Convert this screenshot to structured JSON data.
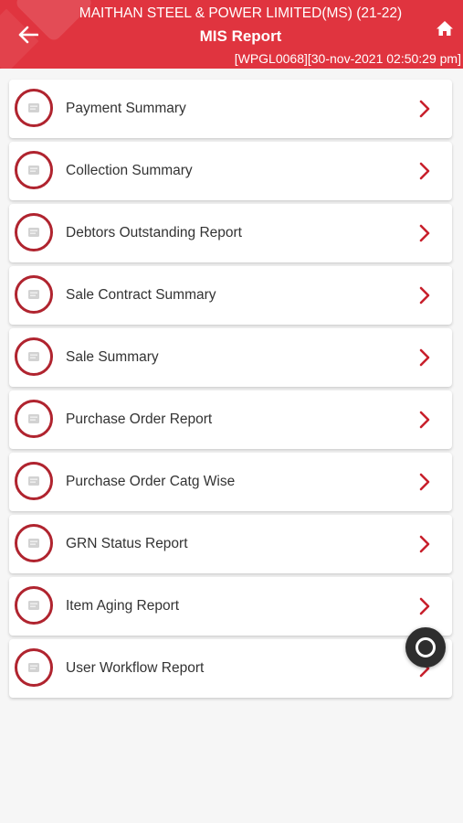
{
  "header": {
    "company": "MAITHAN STEEL & POWER LIMITED(MS) (21-22)",
    "title": "MIS Report",
    "session": "[WPGL0068][30-nov-2021 02:50:29 pm]",
    "back_icon": "arrow-left-icon",
    "home_icon": "home-icon",
    "background_color": "#e0343f"
  },
  "menu": {
    "items": [
      {
        "label": "Payment Summary",
        "icon": "report-icon"
      },
      {
        "label": "Collection Summary",
        "icon": "report-icon"
      },
      {
        "label": "Debtors Outstanding Report",
        "icon": "report-icon"
      },
      {
        "label": "Sale Contract Summary",
        "icon": "report-icon"
      },
      {
        "label": "Sale Summary",
        "icon": "report-icon"
      },
      {
        "label": "Purchase Order Report",
        "icon": "report-icon"
      },
      {
        "label": "Purchase Order Catg Wise",
        "icon": "report-icon"
      },
      {
        "label": "GRN Status Report",
        "icon": "report-icon"
      },
      {
        "label": "Item Aging Report",
        "icon": "report-icon"
      },
      {
        "label": "User Workflow Report",
        "icon": "report-icon"
      }
    ],
    "chevron_color": "#c8202c",
    "icon_ring_color": "#b0242f"
  },
  "fab": {
    "icon": "assistive-touch-icon"
  }
}
